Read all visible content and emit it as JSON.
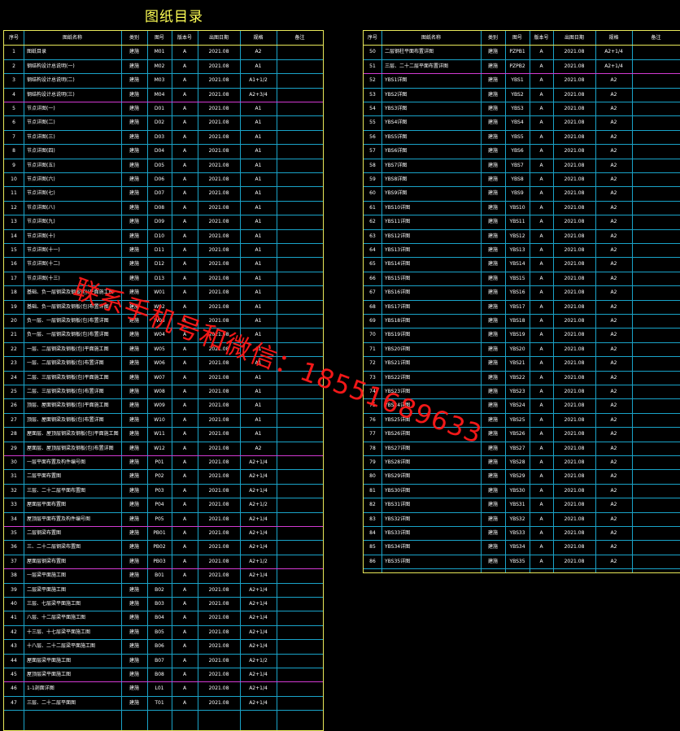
{
  "page_title": "图纸目录",
  "header": [
    "序号",
    "图纸名称",
    "类别",
    "图号",
    "版本号",
    "出图日期",
    "规格",
    "备注"
  ],
  "watermark": "联系手机号和微信：18551689633",
  "colors": {
    "background": "#000000",
    "border": "#e8e85a",
    "grid": "#1aa3c8",
    "accent_row": "#d23ad2",
    "title": "#ffff55",
    "watermark": "#ff1a1a"
  },
  "left_rows": [
    [
      "1",
      "图纸目录",
      "建施",
      "M01",
      "A",
      "2021.08",
      "A2",
      ""
    ],
    [
      "2",
      "钢结构设计总说明(一)",
      "建施",
      "M02",
      "A",
      "2021.08",
      "A1",
      ""
    ],
    [
      "3",
      "钢结构设计总说明(二)",
      "建施",
      "M03",
      "A",
      "2021.08",
      "A1+1/2",
      ""
    ],
    [
      "4",
      "钢结构设计总说明(三)",
      "建施",
      "M04",
      "A",
      "2021.08",
      "A2+3/4",
      ""
    ],
    [
      "5",
      "节点详图(一)",
      "建施",
      "D01",
      "A",
      "2021.08",
      "A1",
      ""
    ],
    [
      "6",
      "节点详图(二)",
      "建施",
      "D02",
      "A",
      "2021.08",
      "A1",
      ""
    ],
    [
      "7",
      "节点详图(三)",
      "建施",
      "D03",
      "A",
      "2021.08",
      "A1",
      ""
    ],
    [
      "8",
      "节点详图(四)",
      "建施",
      "D04",
      "A",
      "2021.08",
      "A1",
      ""
    ],
    [
      "9",
      "节点详图(五)",
      "建施",
      "D05",
      "A",
      "2021.08",
      "A1",
      ""
    ],
    [
      "10",
      "节点详图(六)",
      "建施",
      "D06",
      "A",
      "2021.08",
      "A1",
      ""
    ],
    [
      "11",
      "节点详图(七)",
      "建施",
      "D07",
      "A",
      "2021.08",
      "A1",
      ""
    ],
    [
      "12",
      "节点详图(八)",
      "建施",
      "D08",
      "A",
      "2021.08",
      "A1",
      ""
    ],
    [
      "13",
      "节点详图(九)",
      "建施",
      "D09",
      "A",
      "2021.08",
      "A1",
      ""
    ],
    [
      "14",
      "节点详图(十)",
      "建施",
      "D10",
      "A",
      "2021.08",
      "A1",
      ""
    ],
    [
      "15",
      "节点详图(十一)",
      "建施",
      "D11",
      "A",
      "2021.08",
      "A1",
      ""
    ],
    [
      "16",
      "节点详图(十二)",
      "建施",
      "D12",
      "A",
      "2021.08",
      "A1",
      ""
    ],
    [
      "17",
      "节点详图(十三)",
      "建施",
      "D13",
      "A",
      "2021.08",
      "A1",
      ""
    ],
    [
      "18",
      "基础、负一层钢梁及钢板(包)平面施工图",
      "建施",
      "W01",
      "A",
      "2021.08",
      "A1",
      ""
    ],
    [
      "19",
      "基础、负一层钢梁及钢板(包)布置详图",
      "建施",
      "W02",
      "A",
      "2021.08",
      "A1",
      ""
    ],
    [
      "20",
      "负一层、一层钢梁及钢板(包)布置详图",
      "建施",
      "W03",
      "A",
      "2021.08",
      "A1",
      ""
    ],
    [
      "21",
      "负一层、一层钢梁及钢板(包)布置详图",
      "建施",
      "W04",
      "A",
      "2021.08",
      "A1",
      ""
    ],
    [
      "22",
      "一层、二层钢梁及钢板(包)平面施工图",
      "建施",
      "W05",
      "A",
      "2021.08",
      "A1",
      ""
    ],
    [
      "23",
      "一层、二层钢梁及钢板(包)布置详图",
      "建施",
      "W06",
      "A",
      "2021.08",
      "A1",
      ""
    ],
    [
      "24",
      "二层、三层钢梁及钢板(包)平面施工图",
      "建施",
      "W07",
      "A",
      "2021.08",
      "A1",
      ""
    ],
    [
      "25",
      "二层、三层钢梁及钢板(包)布置详图",
      "建施",
      "W08",
      "A",
      "2021.08",
      "A1",
      ""
    ],
    [
      "26",
      "顶层、屋面钢梁及钢板(包)平面施工图",
      "建施",
      "W09",
      "A",
      "2021.08",
      "A1",
      ""
    ],
    [
      "27",
      "顶层、屋面钢梁及钢板(包)布置详图",
      "建施",
      "W10",
      "A",
      "2021.08",
      "A1",
      ""
    ],
    [
      "28",
      "屋面层、屋顶层钢梁及钢板(包)平面施工图",
      "建施",
      "W11",
      "A",
      "2021.08",
      "A1",
      ""
    ],
    [
      "29",
      "屋面层、屋顶层钢梁及钢板(包)布置详图",
      "建施",
      "W12",
      "A",
      "2021.08",
      "A2",
      ""
    ],
    [
      "30",
      "一层平面布置及构件编号图",
      "建施",
      "P01",
      "A",
      "2021.08",
      "A2+1/4",
      ""
    ],
    [
      "31",
      "二层平面布置图",
      "建施",
      "P02",
      "A",
      "2021.08",
      "A2+1/4",
      ""
    ],
    [
      "32",
      "三层、二十二层平面布置图",
      "建施",
      "P03",
      "A",
      "2021.08",
      "A2+1/4",
      ""
    ],
    [
      "33",
      "屋面层平面布置图",
      "建施",
      "P04",
      "A",
      "2021.08",
      "A2+1/2",
      ""
    ],
    [
      "34",
      "屋顶层平面布置及构件编号图",
      "建施",
      "P05",
      "A",
      "2021.08",
      "A2+1/4",
      ""
    ],
    [
      "35",
      "二层钢梁布置图",
      "建施",
      "PB01",
      "A",
      "2021.08",
      "A2+1/4",
      ""
    ],
    [
      "36",
      "三、二十二层钢梁布置图",
      "建施",
      "PB02",
      "A",
      "2021.08",
      "A2+1/4",
      ""
    ],
    [
      "37",
      "屋面层钢梁布置图",
      "建施",
      "PB03",
      "A",
      "2021.08",
      "A2+1/2",
      ""
    ],
    [
      "38",
      "一层梁平面施工图",
      "建施",
      "B01",
      "A",
      "2021.08",
      "A2+1/4",
      ""
    ],
    [
      "39",
      "二层梁平面施工图",
      "建施",
      "B02",
      "A",
      "2021.08",
      "A2+1/4",
      ""
    ],
    [
      "40",
      "三层、七层梁平面施工图",
      "建施",
      "B03",
      "A",
      "2021.08",
      "A2+1/4",
      ""
    ],
    [
      "41",
      "八层、十二层梁平面施工图",
      "建施",
      "B04",
      "A",
      "2021.08",
      "A2+1/4",
      ""
    ],
    [
      "42",
      "十三层、十七层梁平面施工图",
      "建施",
      "B05",
      "A",
      "2021.08",
      "A2+1/4",
      ""
    ],
    [
      "43",
      "十八层、二十二层梁平面施工图",
      "建施",
      "B06",
      "A",
      "2021.08",
      "A2+1/4",
      ""
    ],
    [
      "44",
      "屋面层梁平面施工图",
      "建施",
      "B07",
      "A",
      "2021.08",
      "A2+1/2",
      ""
    ],
    [
      "45",
      "屋顶层梁平面施工图",
      "建施",
      "B08",
      "A",
      "2021.08",
      "A2+1/4",
      ""
    ],
    [
      "46",
      "1-1剖面详图",
      "建施",
      "L01",
      "A",
      "2021.08",
      "A2+1/4",
      ""
    ],
    [
      "47",
      "三层、二十二层平面图",
      "建施",
      "T01",
      "A",
      "2021.08",
      "A2+1/4",
      ""
    ]
  ],
  "right_rows": [
    [
      "50",
      "二层钢柱平面布置详图",
      "建施",
      "PZPB1",
      "A",
      "2021.08",
      "A2+1/4",
      ""
    ],
    [
      "51",
      "三层、二十二层平面布置详图",
      "建施",
      "PZPB2",
      "A",
      "2021.08",
      "A2+1/4",
      ""
    ],
    [
      "52",
      "YBS1详图",
      "建施",
      "YBS1",
      "A",
      "2021.08",
      "A2",
      ""
    ],
    [
      "53",
      "YBS2详图",
      "建施",
      "YBS2",
      "A",
      "2021.08",
      "A2",
      ""
    ],
    [
      "54",
      "YBS3详图",
      "建施",
      "YBS3",
      "A",
      "2021.08",
      "A2",
      ""
    ],
    [
      "55",
      "YBS4详图",
      "建施",
      "YBS4",
      "A",
      "2021.08",
      "A2",
      ""
    ],
    [
      "56",
      "YBS5详图",
      "建施",
      "YBS5",
      "A",
      "2021.08",
      "A2",
      ""
    ],
    [
      "57",
      "YBS6详图",
      "建施",
      "YBS6",
      "A",
      "2021.08",
      "A2",
      ""
    ],
    [
      "58",
      "YBS7详图",
      "建施",
      "YBS7",
      "A",
      "2021.08",
      "A2",
      ""
    ],
    [
      "59",
      "YBS8详图",
      "建施",
      "YBS8",
      "A",
      "2021.08",
      "A2",
      ""
    ],
    [
      "60",
      "YBS9详图",
      "建施",
      "YBS9",
      "A",
      "2021.08",
      "A2",
      ""
    ],
    [
      "61",
      "YBS10详图",
      "建施",
      "YBS10",
      "A",
      "2021.08",
      "A2",
      ""
    ],
    [
      "62",
      "YBS11详图",
      "建施",
      "YBS11",
      "A",
      "2021.08",
      "A2",
      ""
    ],
    [
      "63",
      "YBS12详图",
      "建施",
      "YBS12",
      "A",
      "2021.08",
      "A2",
      ""
    ],
    [
      "64",
      "YBS13详图",
      "建施",
      "YBS13",
      "A",
      "2021.08",
      "A2",
      ""
    ],
    [
      "65",
      "YBS14详图",
      "建施",
      "YBS14",
      "A",
      "2021.08",
      "A2",
      ""
    ],
    [
      "66",
      "YBS15详图",
      "建施",
      "YBS15",
      "A",
      "2021.08",
      "A2",
      ""
    ],
    [
      "67",
      "YBS16详图",
      "建施",
      "YBS16",
      "A",
      "2021.08",
      "A2",
      ""
    ],
    [
      "68",
      "YBS17详图",
      "建施",
      "YBS17",
      "A",
      "2021.08",
      "A2",
      ""
    ],
    [
      "69",
      "YBS18详图",
      "建施",
      "YBS18",
      "A",
      "2021.08",
      "A2",
      ""
    ],
    [
      "70",
      "YBS19详图",
      "建施",
      "YBS19",
      "A",
      "2021.08",
      "A2",
      ""
    ],
    [
      "71",
      "YBS20详图",
      "建施",
      "YBS20",
      "A",
      "2021.08",
      "A2",
      ""
    ],
    [
      "72",
      "YBS21详图",
      "建施",
      "YBS21",
      "A",
      "2021.08",
      "A2",
      ""
    ],
    [
      "73",
      "YBS22详图",
      "建施",
      "YBS22",
      "A",
      "2021.08",
      "A2",
      ""
    ],
    [
      "74",
      "YBS23详图",
      "建施",
      "YBS23",
      "A",
      "2021.08",
      "A2",
      ""
    ],
    [
      "75",
      "YBS24详图",
      "建施",
      "YBS24",
      "A",
      "2021.08",
      "A2",
      ""
    ],
    [
      "76",
      "YBS25详图",
      "建施",
      "YBS25",
      "A",
      "2021.08",
      "A2",
      ""
    ],
    [
      "77",
      "YBS26详图",
      "建施",
      "YBS26",
      "A",
      "2021.08",
      "A2",
      ""
    ],
    [
      "78",
      "YBS27详图",
      "建施",
      "YBS27",
      "A",
      "2021.08",
      "A2",
      ""
    ],
    [
      "79",
      "YBS28详图",
      "建施",
      "YBS28",
      "A",
      "2021.08",
      "A2",
      ""
    ],
    [
      "80",
      "YBS29详图",
      "建施",
      "YBS29",
      "A",
      "2021.08",
      "A2",
      ""
    ],
    [
      "81",
      "YBS30详图",
      "建施",
      "YBS30",
      "A",
      "2021.08",
      "A2",
      ""
    ],
    [
      "82",
      "YBS31详图",
      "建施",
      "YBS31",
      "A",
      "2021.08",
      "A2",
      ""
    ],
    [
      "83",
      "YBS32详图",
      "建施",
      "YBS32",
      "A",
      "2021.08",
      "A2",
      ""
    ],
    [
      "84",
      "YBS33详图",
      "建施",
      "YBS33",
      "A",
      "2021.08",
      "A2",
      ""
    ],
    [
      "85",
      "YBS34详图",
      "建施",
      "YBS34",
      "A",
      "2021.08",
      "A2",
      ""
    ],
    [
      "86",
      "YBS35详图",
      "建施",
      "YBS35",
      "A",
      "2021.08",
      "A2",
      ""
    ]
  ]
}
